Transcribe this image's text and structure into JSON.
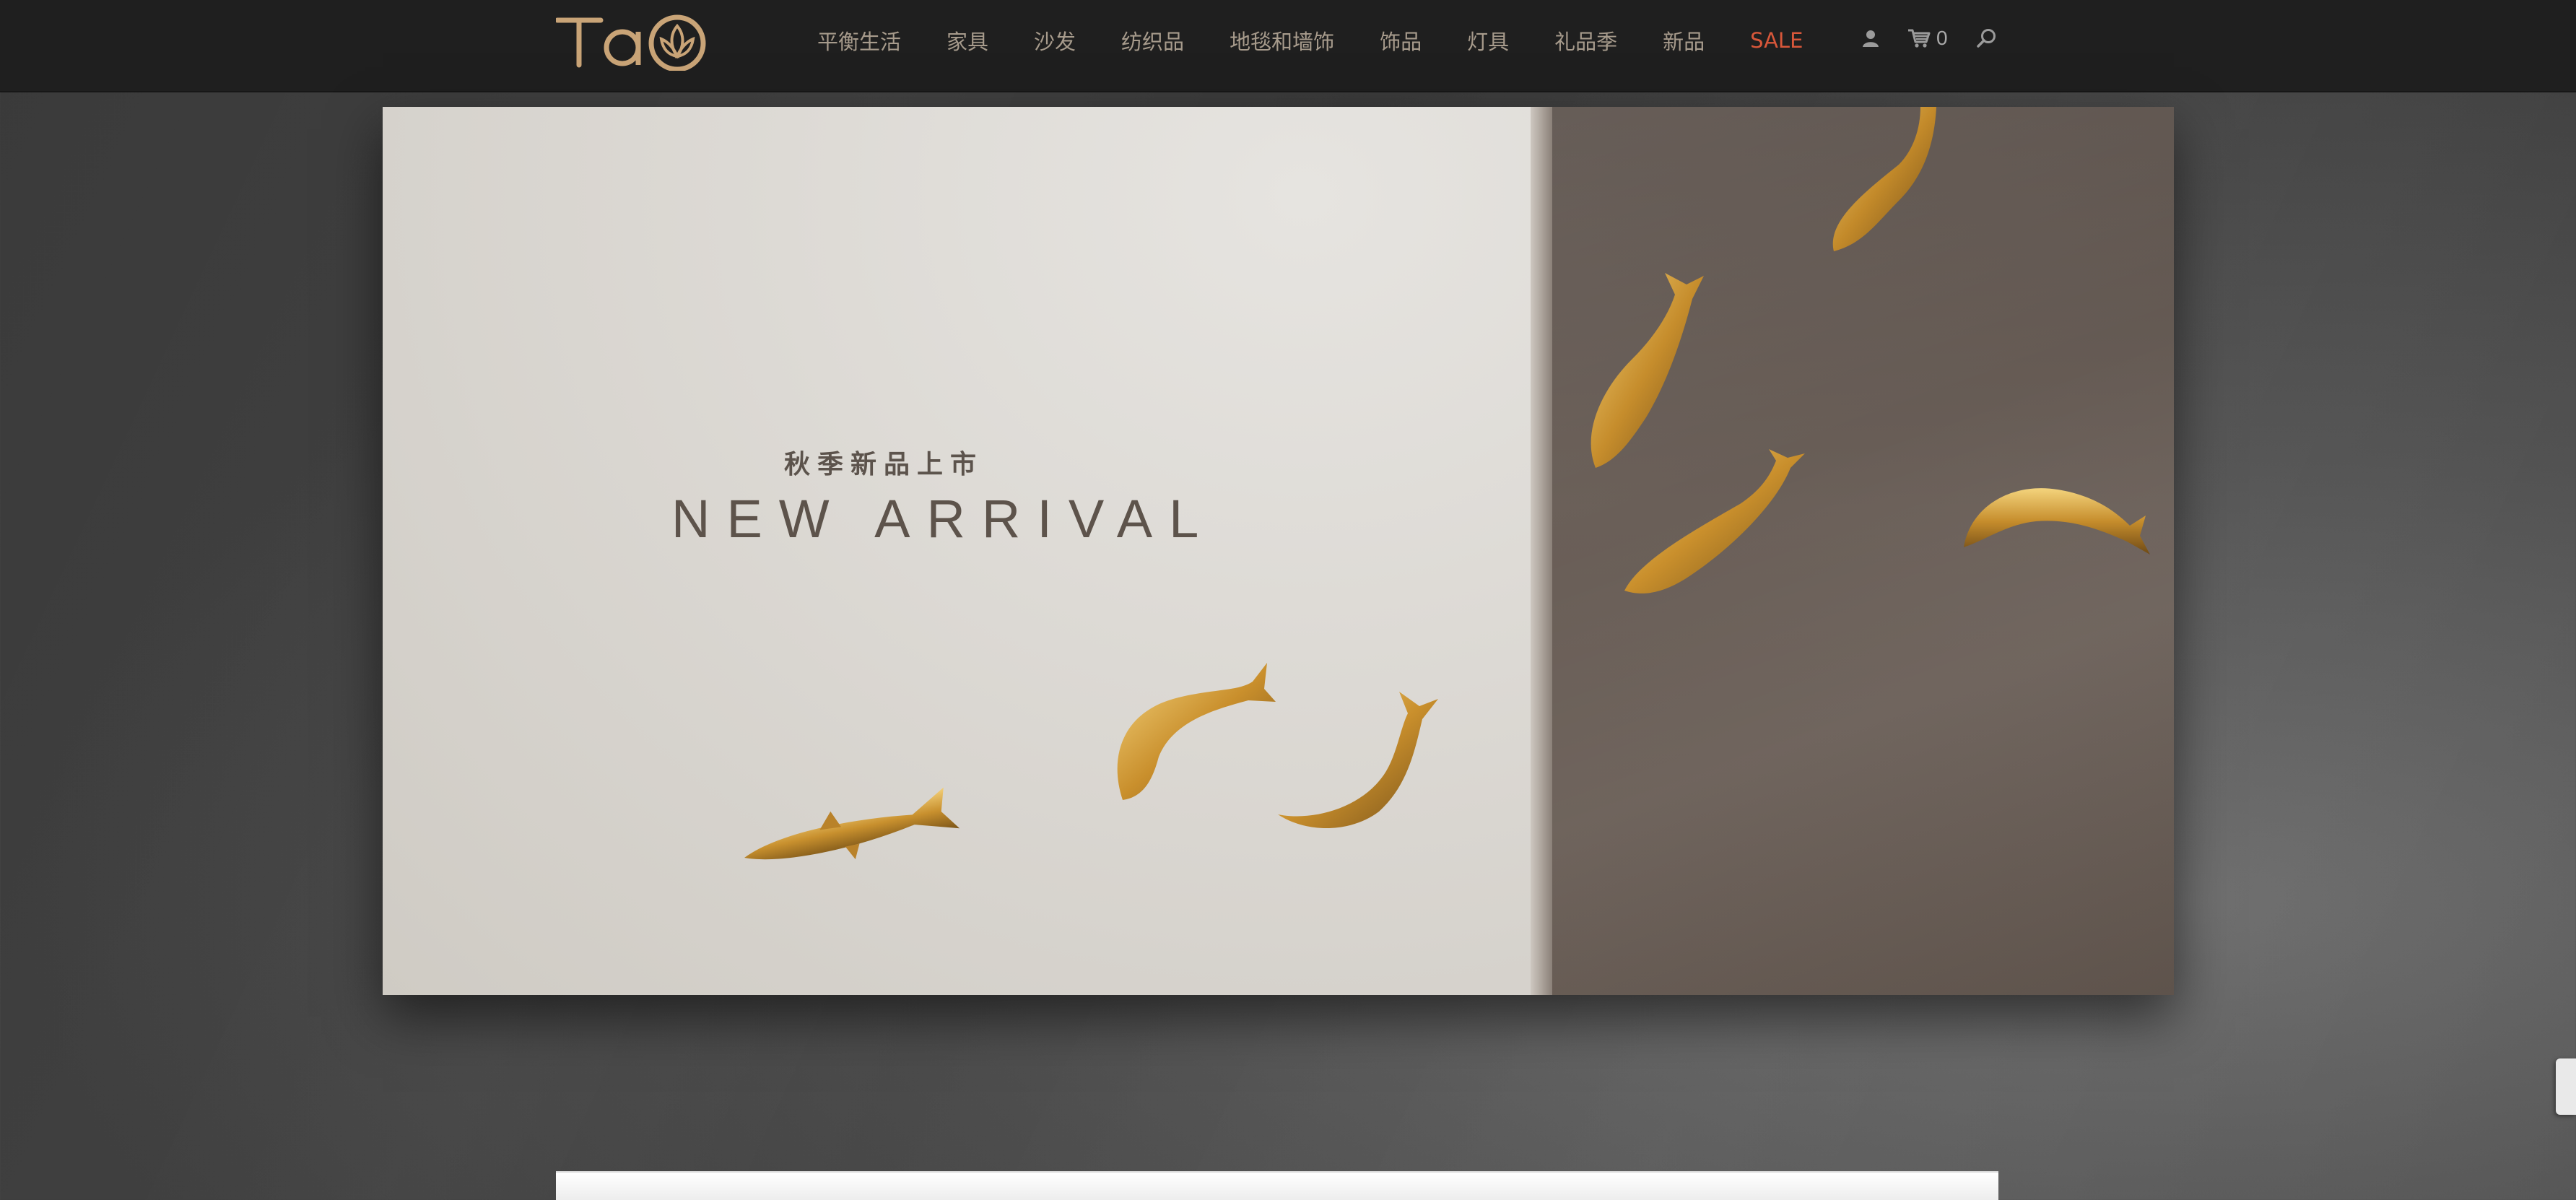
{
  "header": {
    "logo_text": "TAO",
    "nav_items": [
      "平衡生活",
      "家具",
      "沙发",
      "纺织品",
      "地毯和墙饰",
      "饰品",
      "灯具",
      "礼品季",
      "新品",
      "SALE"
    ],
    "cart_count": "0",
    "icons": [
      "user-icon",
      "cart-icon",
      "search-icon"
    ]
  },
  "hero": {
    "subtitle": "秋季新品上市",
    "title": "NEW ARRIVAL"
  },
  "colors": {
    "header_bg": "#1f1f1f",
    "nav_text": "#a79b8c",
    "sale": "#d8573a",
    "gold": "#c99a45"
  }
}
